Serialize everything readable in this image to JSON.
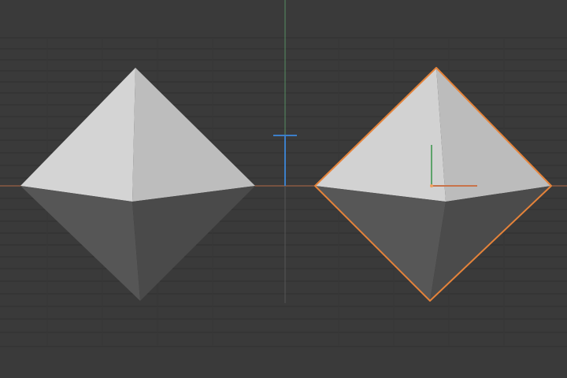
{
  "viewport": {
    "view": "3D viewport",
    "background_color": "#3a3a3a",
    "grid_line_color": "#303030",
    "selection_outline_color": "#e5833a",
    "axis_colors": {
      "x": "#c8734a",
      "y": "#5ea36b",
      "z": "#3c7fc9"
    }
  },
  "objects": [
    {
      "type": "octahedron",
      "selected": false,
      "upper_light_face_color": "#d4d4d4",
      "upper_shaded_face_color": "#bdbdbd",
      "lower_dark_face_color": "#565656",
      "lower_darker_face_color": "#4a4a4a"
    },
    {
      "type": "octahedron",
      "selected": true,
      "upper_light_face_color": "#d2d2d2",
      "upper_shaded_face_color": "#bcbcbc",
      "lower_dark_face_color": "#575757",
      "lower_darker_face_color": "#4b4b4b"
    }
  ]
}
